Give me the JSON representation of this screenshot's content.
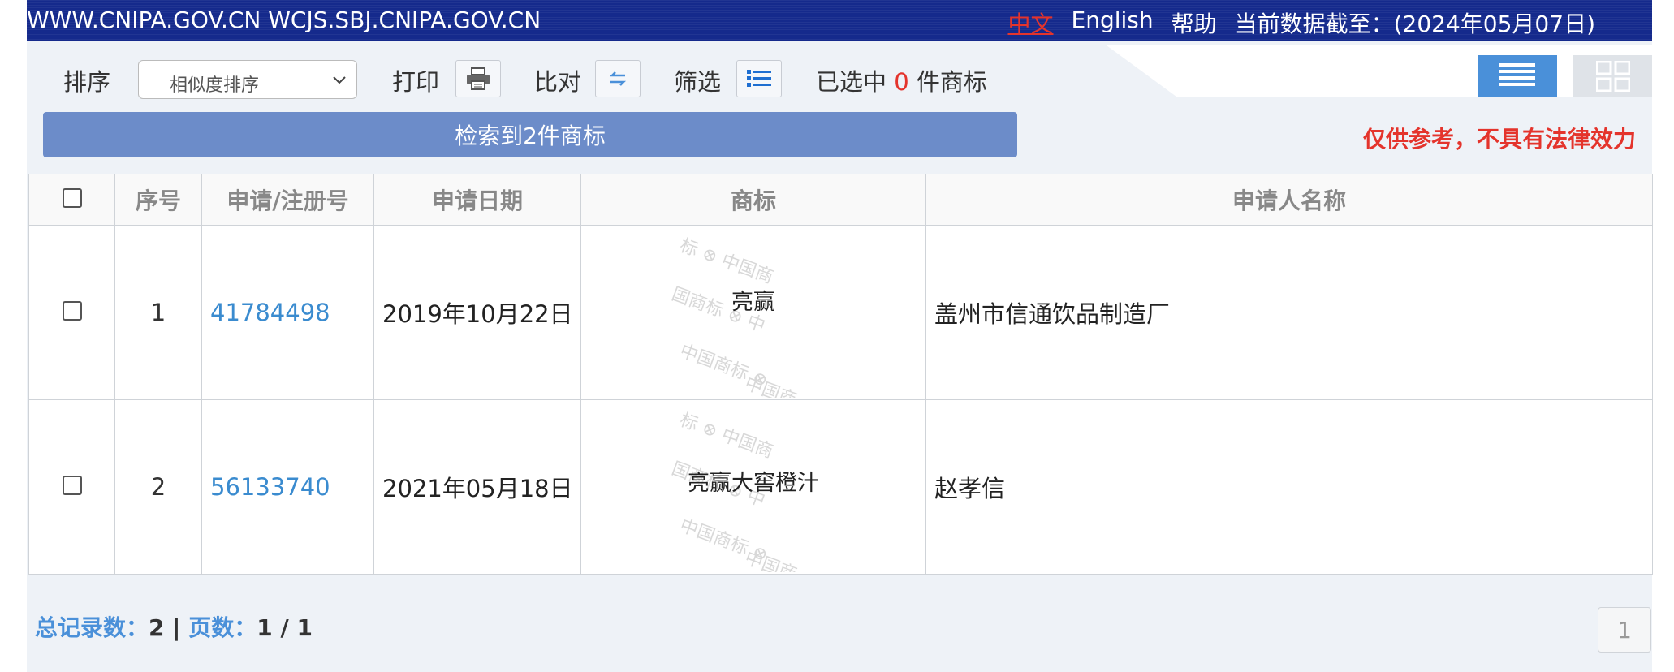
{
  "topbar": {
    "sites": "WWW.CNIPA.GOV.CN WCJS.SBJ.CNIPA.GOV.CN",
    "lang_zh": "中文",
    "lang_en": "English",
    "help": "帮助",
    "data_until": "当前数据截至：(2024年05月07日)"
  },
  "toolbar": {
    "sort_label": "排序",
    "sort_value": "相似度排序",
    "print_label": "打印",
    "compare_label": "比对",
    "filter_label": "筛选",
    "selected_prefix": "已选中",
    "selected_count": "0",
    "selected_suffix": "件商标"
  },
  "result_summary": "检索到2件商标",
  "disclaimer": "仅供参考，不具有法律效力",
  "table": {
    "headers": {
      "seq": "序号",
      "reg_no": "申请/注册号",
      "date": "申请日期",
      "mark": "商标",
      "applicant": "申请人名称"
    },
    "rows": [
      {
        "seq": "1",
        "reg_no": "41784498",
        "date": "2019年10月22日",
        "mark": "亮赢",
        "applicant": "盖州市信通饮品制造厂"
      },
      {
        "seq": "2",
        "reg_no": "56133740",
        "date": "2021年05月18日",
        "mark": "亮赢大窖橙汁",
        "applicant": "赵孝信"
      }
    ]
  },
  "footer": {
    "total_label": "总记录数：",
    "total_value": "2",
    "sep": "|",
    "pages_label": "页数：",
    "pages_value": "1 / 1",
    "current_page": "1"
  },
  "icons": {
    "print": "printer-icon",
    "compare": "swap-arrows-icon",
    "filter": "list-icon",
    "view_list": "list-view-icon",
    "view_grid": "grid-view-icon",
    "sort_dropdown": "chevron-down-icon"
  },
  "colors": {
    "topbar": "#152a8c",
    "accent_blue": "#4a90d9",
    "link": "#3a8bcf",
    "alert_red": "#e4342c",
    "result_bar": "#6c8cc9"
  }
}
